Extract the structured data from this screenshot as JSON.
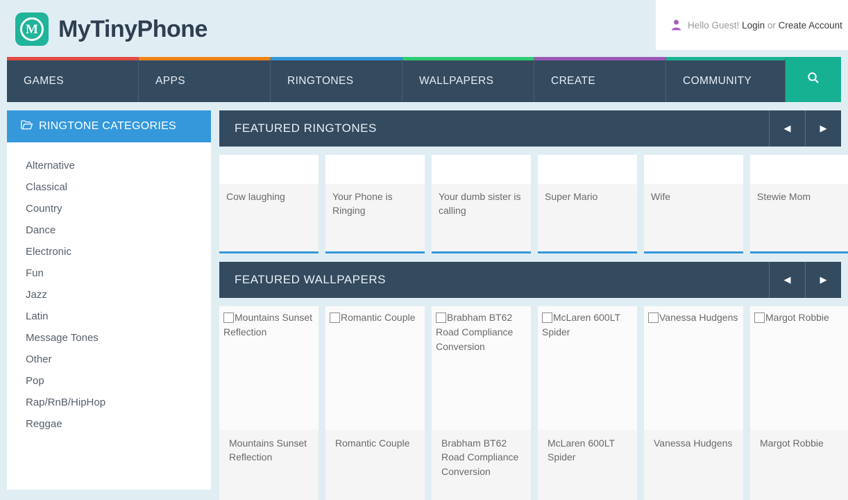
{
  "header": {
    "brand": "MyTinyPhone",
    "logo_letter": "M",
    "greeting": "Hello Guest!",
    "login_label": "Login",
    "or_label": " or ",
    "create_account_label": "Create Account",
    "user_icon": "user-icon"
  },
  "nav": {
    "items": [
      {
        "label": "GAMES",
        "accent": "#e04a41"
      },
      {
        "label": "APPS",
        "accent": "#f08314"
      },
      {
        "label": "RINGTONES",
        "accent": "#3498db"
      },
      {
        "label": "WALLPAPERS",
        "accent": "#2ecc71"
      },
      {
        "label": "CREATE",
        "accent": "#9b59b6"
      },
      {
        "label": "COMMUNITY",
        "accent": "#1ab394"
      }
    ],
    "search_icon": "search-icon",
    "search_bg": "#16b193"
  },
  "sidebar": {
    "title": "RINGTONE CATEGORIES",
    "icon": "folder-open-icon",
    "header_bg": "#3498db",
    "items": [
      {
        "label": "Alternative"
      },
      {
        "label": "Classical"
      },
      {
        "label": "Country"
      },
      {
        "label": "Dance"
      },
      {
        "label": "Electronic"
      },
      {
        "label": "Fun"
      },
      {
        "label": "Jazz"
      },
      {
        "label": "Latin"
      },
      {
        "label": "Message Tones"
      },
      {
        "label": "Other"
      },
      {
        "label": "Pop"
      },
      {
        "label": "Rap/RnB/HipHop"
      },
      {
        "label": "Reggae"
      }
    ]
  },
  "ringtones_panel": {
    "title": "FEATURED RINGTONES",
    "prev_icon": "chevron-left-icon",
    "next_icon": "chevron-right-icon",
    "prev_glyph": "◀",
    "next_glyph": "▶",
    "accent": "#3498db",
    "items": [
      {
        "name": "Cow laughing"
      },
      {
        "name": "Your Phone is Ringing"
      },
      {
        "name": "Your dumb sister is calling"
      },
      {
        "name": "Super Mario"
      },
      {
        "name": "Wife"
      },
      {
        "name": "Stewie Mom"
      }
    ]
  },
  "wallpapers_panel": {
    "title": "FEATURED WALLPAPERS",
    "prev_icon": "chevron-left-icon",
    "next_icon": "chevron-right-icon",
    "prev_glyph": "◀",
    "next_glyph": "▶",
    "accent": "#19b394",
    "items": [
      {
        "alt": "Mountains Sunset Reflection",
        "name": "Mountains Sunset Reflection"
      },
      {
        "alt": "Romantic Couple",
        "name": "Romantic Couple"
      },
      {
        "alt": "Brabham BT62 Road Compliance Conversion",
        "name": "Brabham BT62 Road Compliance Conversion"
      },
      {
        "alt": "McLaren 600LT Spider",
        "name": "McLaren 600LT Spider"
      },
      {
        "alt": "Vanessa Hudgens",
        "name": "Vanessa Hudgens"
      },
      {
        "alt": "Margot Robbie",
        "name": "Margot Robbie"
      }
    ]
  }
}
